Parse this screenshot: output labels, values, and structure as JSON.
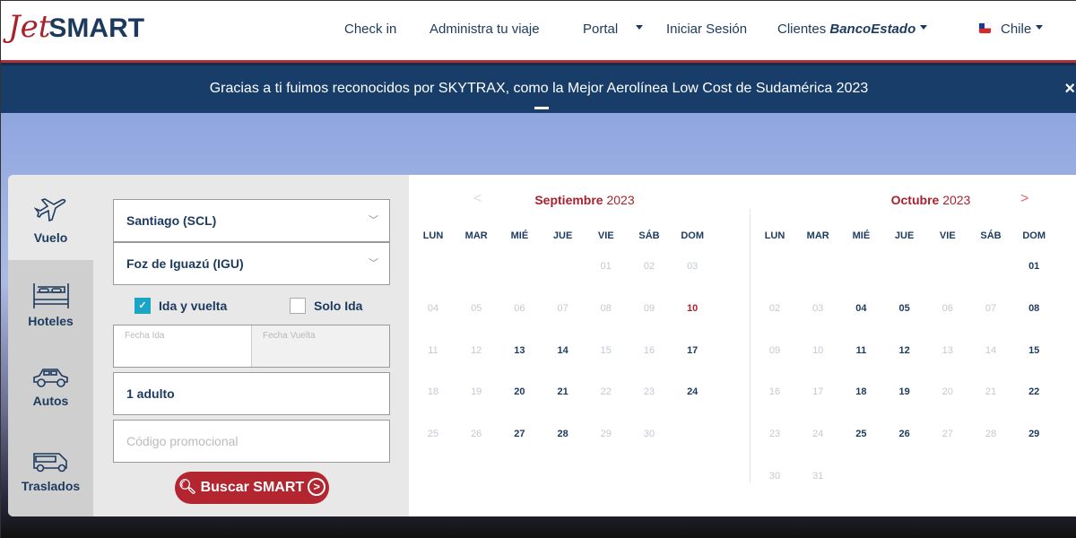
{
  "header": {
    "logo_script": "Jet",
    "logo_bold": "SMART",
    "nav": [
      {
        "label": "Check in"
      },
      {
        "label": "Administra tu viaje"
      },
      {
        "label": "Portal"
      },
      {
        "label": "Iniciar Sesión"
      },
      {
        "label": "Clientes",
        "brand": "BancoEstado"
      },
      {
        "label": "Chile"
      }
    ]
  },
  "banner": {
    "text": "Gracias a ti fuimos reconocidos por SKYTRAX, como la Mejor Aerolínea Low Cost de Sudamérica 2023",
    "close": "×"
  },
  "sidebar": {
    "tabs": [
      {
        "label": "Vuelo",
        "icon": "plane-icon"
      },
      {
        "label": "Hoteles",
        "icon": "bed-icon"
      },
      {
        "label": "Autos",
        "icon": "car-icon"
      },
      {
        "label": "Traslados",
        "icon": "van-icon"
      }
    ]
  },
  "form": {
    "origin": "Santiago (SCL)",
    "destination": "Foz de Iguazú (IGU)",
    "round_trip": "Ida y vuelta",
    "round_trip_checked": true,
    "one_way": "Solo Ida",
    "one_way_checked": false,
    "date_out_label": "Fecha Ida",
    "date_return_label": "Fecha Vuelta",
    "passengers": "1 adulto",
    "promo_placeholder": "Código promocional",
    "search": "Buscar SMART"
  },
  "colors": {
    "brand_navy": "#1c3a5e",
    "brand_red": "#b3252f",
    "banner": "#173d68",
    "checkbox": "#1aa5c5"
  },
  "calendar": {
    "weekdays": [
      "LUN",
      "MAR",
      "MIÉ",
      "JUE",
      "VIE",
      "SÁB",
      "DOM"
    ],
    "months": [
      {
        "name": "Septiembre",
        "year": "2023",
        "offset": 4,
        "days": [
          [
            "01",
            "d"
          ],
          [
            "02",
            "d"
          ],
          [
            "03",
            "d"
          ],
          [
            "04",
            "d"
          ],
          [
            "05",
            "d"
          ],
          [
            "06",
            "d"
          ],
          [
            "07",
            "d"
          ],
          [
            "08",
            "d"
          ],
          [
            "09",
            "d"
          ],
          [
            "10",
            "t"
          ],
          [
            "11",
            "d"
          ],
          [
            "12",
            "d"
          ],
          [
            "13",
            "a"
          ],
          [
            "14",
            "a"
          ],
          [
            "15",
            "d"
          ],
          [
            "16",
            "d"
          ],
          [
            "17",
            "a"
          ],
          [
            "18",
            "d"
          ],
          [
            "19",
            "d"
          ],
          [
            "20",
            "a"
          ],
          [
            "21",
            "a"
          ],
          [
            "22",
            "d"
          ],
          [
            "23",
            "d"
          ],
          [
            "24",
            "a"
          ],
          [
            "25",
            "d"
          ],
          [
            "26",
            "d"
          ],
          [
            "27",
            "a"
          ],
          [
            "28",
            "a"
          ],
          [
            "29",
            "d"
          ],
          [
            "30",
            "d"
          ]
        ]
      },
      {
        "name": "Octubre",
        "year": "2023",
        "offset": 6,
        "days": [
          [
            "01",
            "a"
          ],
          [
            "02",
            "d"
          ],
          [
            "03",
            "d"
          ],
          [
            "04",
            "a"
          ],
          [
            "05",
            "a"
          ],
          [
            "06",
            "d"
          ],
          [
            "07",
            "d"
          ],
          [
            "08",
            "a"
          ],
          [
            "09",
            "d"
          ],
          [
            "10",
            "d"
          ],
          [
            "11",
            "a"
          ],
          [
            "12",
            "a"
          ],
          [
            "13",
            "d"
          ],
          [
            "14",
            "d"
          ],
          [
            "15",
            "a"
          ],
          [
            "16",
            "d"
          ],
          [
            "17",
            "d"
          ],
          [
            "18",
            "a"
          ],
          [
            "19",
            "a"
          ],
          [
            "20",
            "d"
          ],
          [
            "21",
            "d"
          ],
          [
            "22",
            "a"
          ],
          [
            "23",
            "d"
          ],
          [
            "24",
            "d"
          ],
          [
            "25",
            "a"
          ],
          [
            "26",
            "a"
          ],
          [
            "27",
            "d"
          ],
          [
            "28",
            "d"
          ],
          [
            "29",
            "a"
          ],
          [
            "30",
            "d"
          ],
          [
            "31",
            "d"
          ]
        ]
      }
    ]
  }
}
